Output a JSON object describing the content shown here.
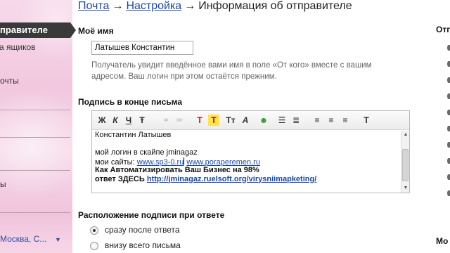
{
  "breadcrumb": {
    "mail": "Почта",
    "settings": "Настройка",
    "arrow1": "→",
    "arrow2": "→",
    "current": "Информация об отправителе"
  },
  "sidebar": {
    "active_item": "правителе",
    "items": [
      "ящиков",
      "очты",
      "ы"
    ],
    "city": "Москва, С..."
  },
  "name_section": {
    "label": "Моё имя",
    "value": "Латышев Константин",
    "hint": "Получатель увидит введённое вами имя в поле «От кого» вместе с вашим адресом. Ваш логин при этом остаётся прежним."
  },
  "signature_section": {
    "label": "Подпись в конце письма",
    "toolbar": [
      "bold-icon",
      "italic-icon",
      "underline-icon",
      "strikethrough-icon",
      "link-icon",
      "unlink-icon",
      "text-color-icon",
      "highlight-color-icon",
      "font-size-icon",
      "font-icon",
      "emoticon-icon",
      "bulleted-list-icon",
      "numbered-list-icon",
      "align-left-icon",
      "align-center-icon",
      "align-right-icon",
      "clear-formatting-icon"
    ],
    "toolbar_glyphs": {
      "bold": "Ж",
      "italic": "К",
      "underline": "Ч",
      "strike": "Ŧ",
      "text_color": "T",
      "highlight": "T",
      "font_size": "Tт",
      "font": "A",
      "clear": "T"
    },
    "signature": {
      "line1": "Константин Латышев",
      "line2_prefix": "мой логин в скайпе jminagaz",
      "line3_prefix": "мои сайты: ",
      "link1": "www.sp3-0.ru",
      "link2": "www.poraperemen.ru",
      "line4": "Как Автоматизировать Ваш Бизнес на 98%",
      "line5_prefix": "ответ ЗДЕСЬ ",
      "link3": "http://jminagaz.ruelsoft.org/virysniimapketing/"
    }
  },
  "placement_section": {
    "label": "Расположение подписи при ответе",
    "options": [
      {
        "label": "сразу после ответа",
        "selected": true
      },
      {
        "label": "внизу всего письма",
        "selected": false
      }
    ]
  },
  "right_column": {
    "head": "Отп",
    "bottom": "Мо"
  },
  "colors": {
    "link": "#1a48b0",
    "active_nav": "#3a3a3a",
    "sidebar_pink": "#f2c7df"
  }
}
